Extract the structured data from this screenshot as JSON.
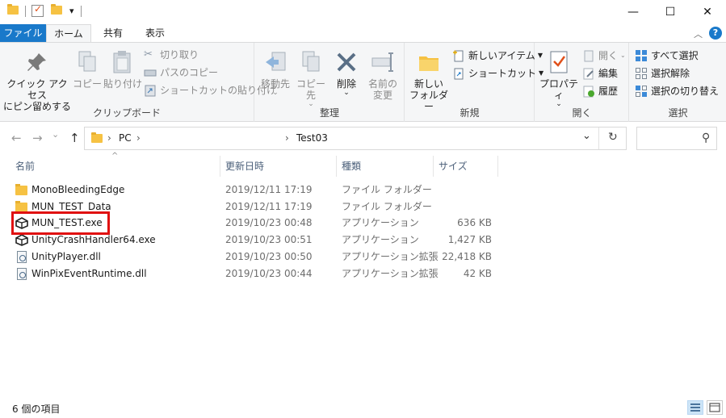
{
  "titlebar": {
    "folder_icon": "folder-icon",
    "properties_icon": "properties-check-icon",
    "newfolder_icon": "new-folder-icon",
    "dropdown_glyph": "▾",
    "minimize": "—",
    "maximize": "☐",
    "close": "✕"
  },
  "tabs": {
    "file": "ファイル",
    "home": "ホーム",
    "share": "共有",
    "view": "表示",
    "collapse_glyph": "︿",
    "help_glyph": "?"
  },
  "ribbon": {
    "clipboard": {
      "label": "クリップボード",
      "pin_line1": "クイック アクセス",
      "pin_line2": "にピン留めする",
      "copy": "コピー",
      "paste": "貼り付け",
      "cut": "切り取り",
      "copy_path": "パスのコピー",
      "paste_shortcut": "ショートカットの貼り付け"
    },
    "organize": {
      "label": "整理",
      "move_to": "移動先",
      "copy_to": "コピー先",
      "delete": "削除",
      "rename_line1": "名前の",
      "rename_line2": "変更"
    },
    "new": {
      "label": "新規",
      "new_folder_line1": "新しい",
      "new_folder_line2": "フォルダー",
      "new_item": "新しいアイテム",
      "shortcut": "ショートカット"
    },
    "open": {
      "label": "開く",
      "properties": "プロパティ",
      "open": "開く",
      "edit": "編集",
      "history": "履歴"
    },
    "select": {
      "label": "選択",
      "select_all": "すべて選択",
      "select_none": "選択解除",
      "invert": "選択の切り替え"
    }
  },
  "address": {
    "back_glyph": "←",
    "forward_glyph": "→",
    "recent_glyph": "⌄",
    "up_glyph": "↑",
    "crumb_pc": "PC",
    "crumb_sep": "›",
    "crumb_folder": "Test03",
    "dropdown_glyph": "⌄",
    "refresh_glyph": "↻",
    "search_glyph": "⚲"
  },
  "columns": {
    "name": "名前",
    "date": "更新日時",
    "type": "種類",
    "size": "サイズ",
    "sort_glyph": "^"
  },
  "files": [
    {
      "name": "MonoBleedingEdge",
      "date": "2019/12/11 17:19",
      "type": "ファイル フォルダー",
      "size": "",
      "icon": "folder-icon"
    },
    {
      "name": "MUN_TEST_Data",
      "date": "2019/12/11 17:19",
      "type": "ファイル フォルダー",
      "size": "",
      "icon": "folder-icon"
    },
    {
      "name": "MUN_TEST.exe",
      "date": "2019/10/23 00:48",
      "type": "アプリケーション",
      "size": "636 KB",
      "icon": "unity-icon"
    },
    {
      "name": "UnityCrashHandler64.exe",
      "date": "2019/10/23 00:51",
      "type": "アプリケーション",
      "size": "1,427 KB",
      "icon": "unity-icon"
    },
    {
      "name": "UnityPlayer.dll",
      "date": "2019/10/23 00:50",
      "type": "アプリケーション拡張",
      "size": "22,418 KB",
      "icon": "dll-icon"
    },
    {
      "name": "WinPixEventRuntime.dll",
      "date": "2019/10/23 00:44",
      "type": "アプリケーション拡張",
      "size": "42 KB",
      "icon": "dll-icon"
    }
  ],
  "status": {
    "item_count": "6 個の項目"
  },
  "colors": {
    "file_tab": "#1979ca",
    "highlight": "#e01010",
    "folder": "#f6c243"
  }
}
